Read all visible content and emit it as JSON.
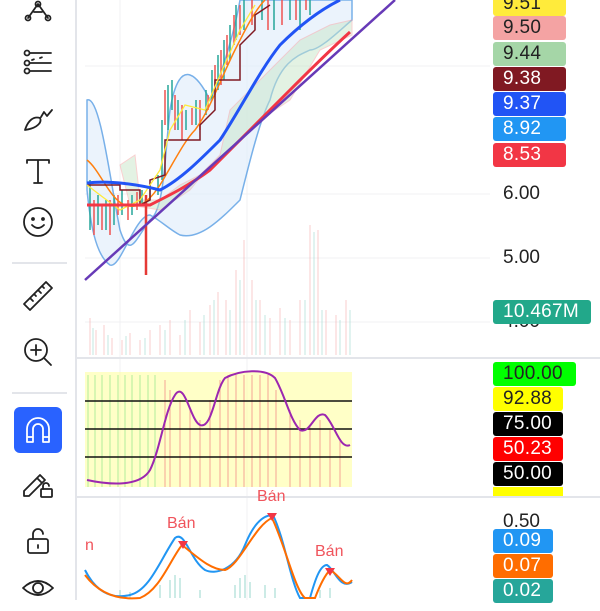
{
  "toolbar": {
    "items": [
      {
        "name": "pattern-tool",
        "icon": "pattern-icon"
      },
      {
        "name": "prediction-tool",
        "icon": "projection-icon"
      },
      {
        "name": "brush-tool",
        "icon": "brush-icon"
      },
      {
        "name": "text-tool",
        "icon": "text-icon"
      },
      {
        "name": "emoji-tool",
        "icon": "smiley-icon"
      },
      {
        "name": "measure-tool",
        "icon": "ruler-icon"
      },
      {
        "name": "zoom-in-tool",
        "icon": "zoom-in-icon"
      },
      {
        "name": "magnet-mode",
        "icon": "magnet-icon",
        "active": true
      },
      {
        "name": "stay-in-drawing-mode",
        "icon": "pencil-lock-icon"
      },
      {
        "name": "lock-drawings",
        "icon": "unlock-icon"
      },
      {
        "name": "hide-drawings",
        "icon": "eye-icon"
      }
    ]
  },
  "price_axis": {
    "labels": [
      {
        "value": "9.51",
        "bg": "#ffeb3b",
        "fg": "#222"
      },
      {
        "value": "9.50",
        "bg": "#f4a3a3",
        "fg": "#222"
      },
      {
        "value": "9.44",
        "bg": "#a5d6a7",
        "fg": "#222"
      },
      {
        "value": "9.38",
        "bg": "#801922",
        "fg": "#fff"
      },
      {
        "value": "9.37",
        "bg": "#2154f5",
        "fg": "#fff"
      },
      {
        "value": "8.92",
        "bg": "#2196f3",
        "fg": "#fff"
      },
      {
        "value": "8.53",
        "bg": "#f23645",
        "fg": "#fff"
      }
    ],
    "ticks": [
      "6.00",
      "5.00",
      "4.00"
    ],
    "volume_label": {
      "value": "10.467M",
      "bg": "#22a88a",
      "fg": "#fff"
    }
  },
  "oscillator_axis": {
    "labels": [
      {
        "value": "100.00",
        "bg": "#00ff00",
        "fg": "#222"
      },
      {
        "value": "92.88",
        "bg": "#ffff00",
        "fg": "#222"
      },
      {
        "value": "75.00",
        "bg": "#000000",
        "fg": "#fff"
      },
      {
        "value": "50.23",
        "bg": "#ff0000",
        "fg": "#fff"
      },
      {
        "value": "50.00",
        "bg": "#000000",
        "fg": "#fff"
      }
    ]
  },
  "macd_axis": {
    "tick": "0.50",
    "labels": [
      {
        "value": "0.09",
        "bg": "#2196f3",
        "fg": "#fff"
      },
      {
        "value": "0.07",
        "bg": "#ff6d00",
        "fg": "#fff"
      },
      {
        "value": "0.02",
        "bg": "#26a69a",
        "fg": "#fff"
      }
    ]
  },
  "signals": {
    "sell_label": "Bán",
    "partial_label": "n"
  }
}
